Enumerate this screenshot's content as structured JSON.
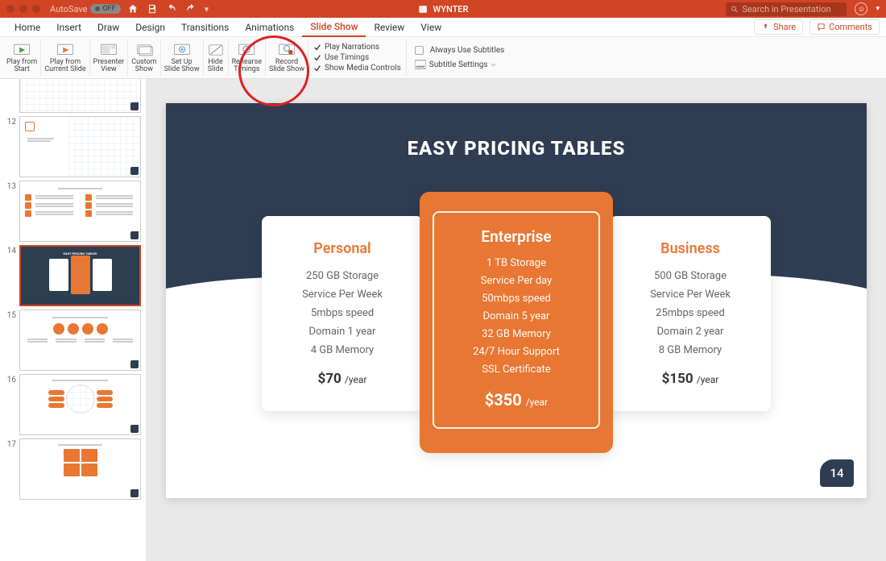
{
  "titlebar": {
    "autosave_label": "AutoSave",
    "autosave_state": "OFF",
    "doc_title": "WYNTER",
    "search_placeholder": "Search in Presentation"
  },
  "menu": {
    "tabs": [
      "Home",
      "Insert",
      "Draw",
      "Design",
      "Transitions",
      "Animations",
      "Slide Show",
      "Review",
      "View"
    ],
    "active_tab": "Slide Show",
    "share_label": "Share",
    "comments_label": "Comments"
  },
  "ribbon": {
    "play_from_start": "Play from\nStart",
    "play_from_current": "Play from\nCurrent Slide",
    "presenter_view": "Presenter\nView",
    "custom_show": "Custom\nShow",
    "set_up": "Set Up\nSlide Show",
    "hide_slide": "Hide\nSlide",
    "rehearse": "Rehearse\nTimings",
    "record": "Record\nSlide Show",
    "play_narrations": "Play Narrations",
    "use_timings": "Use Timings",
    "show_media": "Show Media Controls",
    "always_subtitles": "Always Use Subtitles",
    "subtitle_settings": "Subtitle Settings"
  },
  "thumbnails": {
    "visible_numbers": [
      "12",
      "13",
      "14",
      "15",
      "16",
      "17"
    ],
    "active_index": "14"
  },
  "slide": {
    "title": "EASY PRICING TABLES",
    "page_number": "14",
    "plans": {
      "personal": {
        "name": "Personal",
        "features": [
          "250 GB Storage",
          "Service Per Week",
          "5mbps speed",
          "Domain 1 year",
          "4 GB Memory"
        ],
        "price": "$70",
        "period": "/year"
      },
      "enterprise": {
        "name": "Enterprise",
        "features": [
          "1 TB Storage",
          "Service Per day",
          "50mbps speed",
          "Domain 5 year",
          "32 GB Memory",
          "24/7 Hour Support",
          "SSL Certificate"
        ],
        "price": "$350",
        "period": "/year"
      },
      "business": {
        "name": "Business",
        "features": [
          "500 GB Storage",
          "Service Per Week",
          "25mbps speed",
          "Domain 2 year",
          "8 GB Memory"
        ],
        "price": "$150",
        "period": "/year"
      }
    }
  }
}
